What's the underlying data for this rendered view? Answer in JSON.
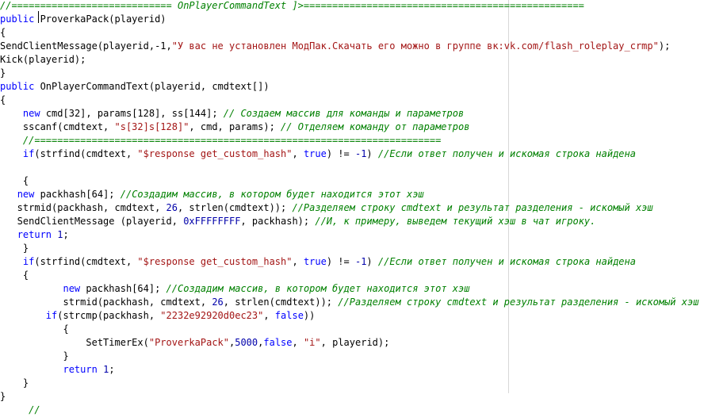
{
  "lines": [
    [
      {
        "t": "//============================ OnPlayerCommandText ]>=================================================",
        "c": "cm"
      }
    ],
    [
      {
        "t": "public",
        "c": "kw"
      },
      {
        "t": " ProverkaPack(playerid)",
        "c": ""
      }
    ],
    [
      {
        "t": "{",
        "c": ""
      }
    ],
    [
      {
        "t": "SendClientMessage(playerid,-1,",
        "c": ""
      },
      {
        "t": "\"У вас не установлен МодПак.Скачать его можно в группе вк:vk.com/flash_roleplay_crmp\"",
        "c": "str"
      },
      {
        "t": ");",
        "c": ""
      }
    ],
    [
      {
        "t": "Kick(playerid);",
        "c": ""
      }
    ],
    [
      {
        "t": "}",
        "c": ""
      }
    ],
    [
      {
        "t": "public",
        "c": "kw"
      },
      {
        "t": " OnPlayerCommandText(playerid, cmdtext[])",
        "c": ""
      }
    ],
    [
      {
        "t": "{",
        "c": ""
      }
    ],
    [
      {
        "t": "    ",
        "c": ""
      },
      {
        "t": "new",
        "c": "kw"
      },
      {
        "t": " cmd[32], params[128], ss[144]; ",
        "c": ""
      },
      {
        "t": "// Создаем массив для команды и параметров",
        "c": "cm"
      }
    ],
    [
      {
        "t": "    sscanf(cmdtext, ",
        "c": ""
      },
      {
        "t": "\"s[32]s[128]\"",
        "c": "str"
      },
      {
        "t": ", cmd, params); ",
        "c": ""
      },
      {
        "t": "// Отделяем команду от параметров",
        "c": "cm"
      }
    ],
    [
      {
        "t": "    ",
        "c": ""
      },
      {
        "t": "//=======================================================================",
        "c": "cm"
      }
    ],
    [
      {
        "t": "    ",
        "c": ""
      },
      {
        "t": "if",
        "c": "kw"
      },
      {
        "t": "(strfind(cmdtext, ",
        "c": ""
      },
      {
        "t": "\"$response get_custom_hash\"",
        "c": "str"
      },
      {
        "t": ", ",
        "c": ""
      },
      {
        "t": "true",
        "c": "kw"
      },
      {
        "t": ") != ",
        "c": ""
      },
      {
        "t": "-1",
        "c": "num"
      },
      {
        "t": ") ",
        "c": ""
      },
      {
        "t": "//Если ответ получен и искомая строка найдена",
        "c": "cm"
      }
    ],
    [
      {
        "t": "",
        "c": ""
      }
    ],
    [
      {
        "t": "    {",
        "c": ""
      }
    ],
    [
      {
        "t": "   ",
        "c": ""
      },
      {
        "t": "new",
        "c": "kw"
      },
      {
        "t": " packhash[64]; ",
        "c": ""
      },
      {
        "t": "//Создадим массив, в котором будет находится этот хэш",
        "c": "cm"
      }
    ],
    [
      {
        "t": "   strmid(packhash, cmdtext, ",
        "c": ""
      },
      {
        "t": "26",
        "c": "num"
      },
      {
        "t": ", strlen(cmdtext)); ",
        "c": ""
      },
      {
        "t": "//Разделяем строку cmdtext и результат разделения - искомый хэш",
        "c": "cm"
      }
    ],
    [
      {
        "t": "   SendClientMessage (playerid, ",
        "c": ""
      },
      {
        "t": "0xFFFFFFFF",
        "c": "num"
      },
      {
        "t": ", packhash); ",
        "c": ""
      },
      {
        "t": "//И, к примеру, выведем текущий хэш в чат игроку.",
        "c": "cm"
      }
    ],
    [
      {
        "t": "   ",
        "c": ""
      },
      {
        "t": "return",
        "c": "kw"
      },
      {
        "t": " ",
        "c": ""
      },
      {
        "t": "1",
        "c": "num"
      },
      {
        "t": ";",
        "c": ""
      }
    ],
    [
      {
        "t": "    }",
        "c": ""
      }
    ],
    [
      {
        "t": "    ",
        "c": ""
      },
      {
        "t": "if",
        "c": "kw"
      },
      {
        "t": "(strfind(cmdtext, ",
        "c": ""
      },
      {
        "t": "\"$response get_custom_hash\"",
        "c": "str"
      },
      {
        "t": ", ",
        "c": ""
      },
      {
        "t": "true",
        "c": "kw"
      },
      {
        "t": ") != ",
        "c": ""
      },
      {
        "t": "-1",
        "c": "num"
      },
      {
        "t": ") ",
        "c": ""
      },
      {
        "t": "//Если ответ получен и искомая строка найдена",
        "c": "cm"
      }
    ],
    [
      {
        "t": "    {",
        "c": ""
      }
    ],
    [
      {
        "t": "           ",
        "c": ""
      },
      {
        "t": "new",
        "c": "kw"
      },
      {
        "t": " packhash[64]; ",
        "c": ""
      },
      {
        "t": "//Создадим массив, в котором будет находится этот хэш",
        "c": "cm"
      }
    ],
    [
      {
        "t": "           strmid(packhash, cmdtext, ",
        "c": ""
      },
      {
        "t": "26",
        "c": "num"
      },
      {
        "t": ", strlen(cmdtext)); ",
        "c": ""
      },
      {
        "t": "//Разделяем строку cmdtext и результат разделения - искомый хэш",
        "c": "cm"
      }
    ],
    [
      {
        "t": "        ",
        "c": ""
      },
      {
        "t": "if",
        "c": "kw"
      },
      {
        "t": "(strcmp(packhash, ",
        "c": ""
      },
      {
        "t": "\"2232e92920d0ec23\"",
        "c": "str"
      },
      {
        "t": ", ",
        "c": ""
      },
      {
        "t": "false",
        "c": "kw"
      },
      {
        "t": "))",
        "c": ""
      }
    ],
    [
      {
        "t": "           {",
        "c": ""
      }
    ],
    [
      {
        "t": "               SetTimerEx(",
        "c": ""
      },
      {
        "t": "\"ProverkaPack\"",
        "c": "str"
      },
      {
        "t": ",",
        "c": ""
      },
      {
        "t": "5000",
        "c": "num"
      },
      {
        "t": ",",
        "c": ""
      },
      {
        "t": "false",
        "c": "kw"
      },
      {
        "t": ", ",
        "c": ""
      },
      {
        "t": "\"i\"",
        "c": "str"
      },
      {
        "t": ", playerid);",
        "c": ""
      }
    ],
    [
      {
        "t": "           }",
        "c": ""
      }
    ],
    [
      {
        "t": "           ",
        "c": ""
      },
      {
        "t": "return",
        "c": "kw"
      },
      {
        "t": " ",
        "c": ""
      },
      {
        "t": "1",
        "c": "num"
      },
      {
        "t": ";",
        "c": ""
      }
    ],
    [
      {
        "t": "    }",
        "c": ""
      }
    ],
    [
      {
        "t": "}",
        "c": ""
      }
    ],
    [
      {
        "t": "     ",
        "c": ""
      },
      {
        "t": "//",
        "c": "cm"
      }
    ]
  ]
}
